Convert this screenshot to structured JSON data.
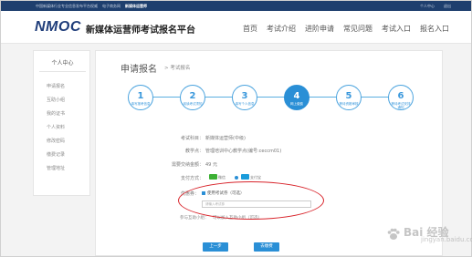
{
  "topbar": {
    "links": [
      "中国新媒体行业专业信息发布平台权威",
      "电子商务网",
      "新媒体运营师"
    ],
    "right": [
      "个人中心",
      "退出"
    ]
  },
  "header": {
    "logo_en": "NMOC",
    "logo_cn": "新媒体运营师考试报名平台",
    "nav": [
      "首页",
      "考试介绍",
      "进阶申请",
      "常见问题",
      "考试入口",
      "报名入口"
    ]
  },
  "sidebar": {
    "title": "个人中心",
    "items": [
      "申请报名",
      "互助小组",
      "我的证书",
      "个人资料",
      "修改密码",
      "缴费记录",
      "管理地址"
    ]
  },
  "main": {
    "title": "申请报名",
    "breadcrumb": "> 考试报名"
  },
  "steps": [
    {
      "num": "1",
      "label": "填写报考信息"
    },
    {
      "num": "2",
      "label": "阅读考试须知"
    },
    {
      "num": "3",
      "label": "填写个人信息"
    },
    {
      "num": "4",
      "label": "网上缴费"
    },
    {
      "num": "5",
      "label": "等待资格审核"
    },
    {
      "num": "6",
      "label": "等待考试安排通知"
    }
  ],
  "form": {
    "exam_subject_label": "考试科目：",
    "exam_subject_value": "新媒体运营师(中级)",
    "teaching_point_label": "教学点：",
    "teaching_point_value": "管理培训中心教学点(编号:ceccm01)",
    "fee_label": "需要交纳金额：",
    "fee_value": "49 元",
    "payment_label": "支付方式：",
    "payment_wechat": "微信",
    "payment_alipay": "支付宝",
    "coupon_label": "优惠券：",
    "coupon_checkbox": "使用考试劵（可选）",
    "coupon_placeholder": "请输入考试劵",
    "agree_label": "参与互助小组：",
    "agree_text": "可以加入互助小组（可选）"
  },
  "buttons": {
    "prev": "上一步",
    "pay": "去缴费"
  },
  "watermark": {
    "text": "Bai 经验",
    "sub": "jingyan.baidu.com"
  },
  "colors": {
    "topbar": "#1e3f6e",
    "accent": "#2a8fd6",
    "highlight_ellipse": "#d8232a"
  }
}
